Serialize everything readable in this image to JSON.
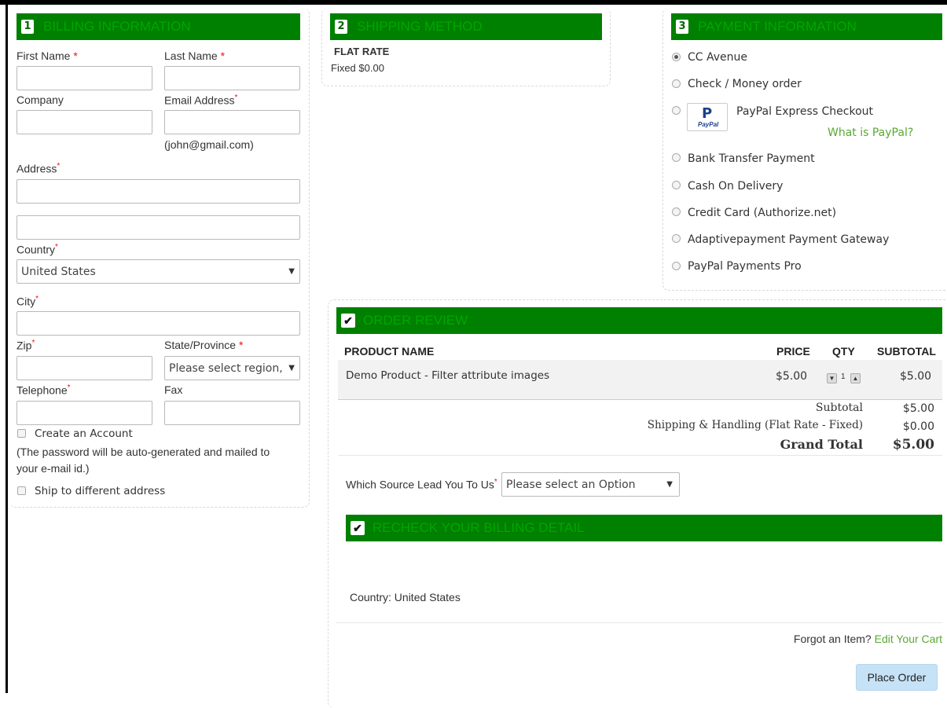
{
  "billing": {
    "step": "1",
    "title": "BILLING INFORMATION",
    "first_name_label": "First Name",
    "last_name_label": "Last Name",
    "company_label": "Company",
    "email_label": "Email Address",
    "email_hint": "(john@gmail.com)",
    "address_label": "Address",
    "country_label": "Country",
    "country_value": "United States",
    "city_label": "City",
    "zip_label": "Zip",
    "state_label": "State/Province",
    "state_value": "Please select region,",
    "telephone_label": "Telephone",
    "fax_label": "Fax",
    "create_account_label": "Create an Account",
    "password_note": "(The password will be auto-generated and mailed to your e-mail id.)",
    "ship_different_label": "Ship to different address",
    "required_mark": "*"
  },
  "shipping": {
    "step": "2",
    "title": "SHIPPING METHOD",
    "method_name": "FLAT RATE",
    "method_price": "Fixed $0.00"
  },
  "payment": {
    "step": "3",
    "title": "PAYMENT INFORMATION",
    "selected": "CC Avenue",
    "options": [
      "CC Avenue",
      "Check / Money order",
      "PayPal Express Checkout",
      "Bank Transfer Payment",
      "Cash On Delivery",
      "Credit Card (Authorize.net)",
      "Adaptivepayment Payment Gateway",
      "PayPal Payments Pro"
    ],
    "paypal_logo_text": "PayPal",
    "what_is_paypal": "What is PayPal?"
  },
  "review": {
    "title": "ORDER REVIEW",
    "columns": {
      "product": "PRODUCT NAME",
      "price": "PRICE",
      "qty": "QTY",
      "subtotal": "SUBTOTAL"
    },
    "rows": [
      {
        "product": "Demo Product - Filter attribute images",
        "price": "$5.00",
        "qty": "1",
        "subtotal": "$5.00"
      }
    ],
    "subtotal_label": "Subtotal",
    "subtotal_value": "$5.00",
    "shipping_label": "Shipping & Handling (Flat Rate - Fixed)",
    "shipping_value": "$0.00",
    "grand_total_label": "Grand Total",
    "grand_total_value": "$5.00",
    "source_label": "Which Source Lead You To Us",
    "source_value": "Please select an Option"
  },
  "recheck": {
    "title": "RECHECK YOUR BILLING DETAIL",
    "country_line": "Country: United States"
  },
  "footer": {
    "forgot_text": "Forgot an Item?",
    "edit_cart": "Edit Your Cart",
    "place_order": "Place Order"
  },
  "colors": {
    "header_green": "#008000",
    "header_text": "#00a600",
    "link_green": "#5aa832",
    "button_blue": "#c6e2f6",
    "required_red": "#e11111"
  }
}
